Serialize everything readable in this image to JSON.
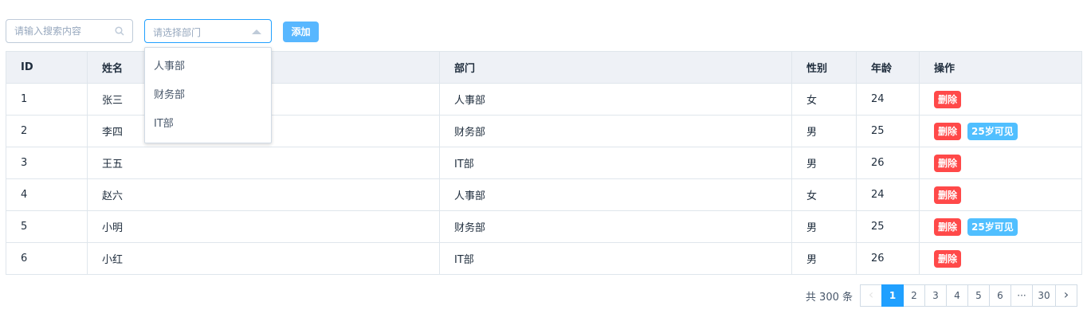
{
  "search": {
    "placeholder": "请输入搜索内容"
  },
  "dept_select": {
    "placeholder": "请选择部门",
    "options": [
      "人事部",
      "财务部",
      "IT部"
    ]
  },
  "toolbar": {
    "add_label": "添加"
  },
  "table": {
    "headers": {
      "id": "ID",
      "name": "姓名",
      "dept": "部门",
      "gender": "性别",
      "age": "年龄",
      "ops": "操作"
    },
    "rows": [
      {
        "id": "1",
        "name": "张三",
        "dept": "人事部",
        "gender": "女",
        "age": "24",
        "delete": "删除",
        "extra": ""
      },
      {
        "id": "2",
        "name": "李四",
        "dept": "财务部",
        "gender": "男",
        "age": "25",
        "delete": "删除",
        "extra": "25岁可见"
      },
      {
        "id": "3",
        "name": "王五",
        "dept": "IT部",
        "gender": "男",
        "age": "26",
        "delete": "删除",
        "extra": ""
      },
      {
        "id": "4",
        "name": "赵六",
        "dept": "人事部",
        "gender": "女",
        "age": "24",
        "delete": "删除",
        "extra": ""
      },
      {
        "id": "5",
        "name": "小明",
        "dept": "财务部",
        "gender": "男",
        "age": "25",
        "delete": "删除",
        "extra": "25岁可见"
      },
      {
        "id": "6",
        "name": "小红",
        "dept": "IT部",
        "gender": "男",
        "age": "26",
        "delete": "删除",
        "extra": ""
      }
    ]
  },
  "pagination": {
    "total": "共 300 条",
    "pages": [
      "1",
      "2",
      "3",
      "4",
      "5",
      "6"
    ],
    "ellipsis": "···",
    "last_page": "30",
    "prev": "‹",
    "next": "›",
    "current": "1"
  },
  "colors": {
    "primary": "#20a0ff",
    "danger": "#ff4949",
    "info": "#50bfff",
    "add_button": "#58b7ff"
  },
  "icons": {
    "search": "search-icon",
    "caret": "caret-up-icon",
    "prev": "chevron-left-icon",
    "next": "chevron-right-icon"
  }
}
